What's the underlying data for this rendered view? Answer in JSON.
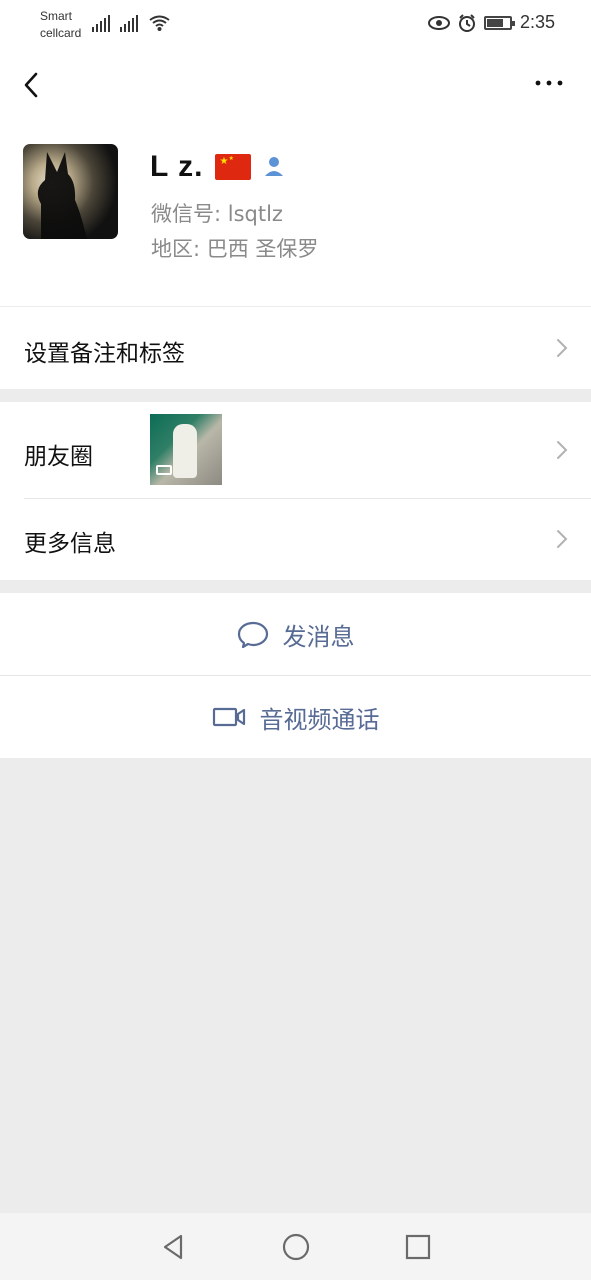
{
  "status_bar": {
    "carrier_line1": "Smart",
    "carrier_line2": "cellcard",
    "time": "2:35",
    "battery_level": 0.65
  },
  "profile": {
    "name": "L  z.",
    "wechat_id": "微信号: lsqtlz",
    "region": "地区: 巴西  圣保罗"
  },
  "menu": {
    "remark_tags": "设置备注和标签",
    "moments": "朋友圈",
    "more_info": "更多信息"
  },
  "actions": {
    "message": "发消息",
    "video_call": "音视频通话"
  },
  "colors": {
    "link": "#576b95",
    "background": "#ececec"
  }
}
